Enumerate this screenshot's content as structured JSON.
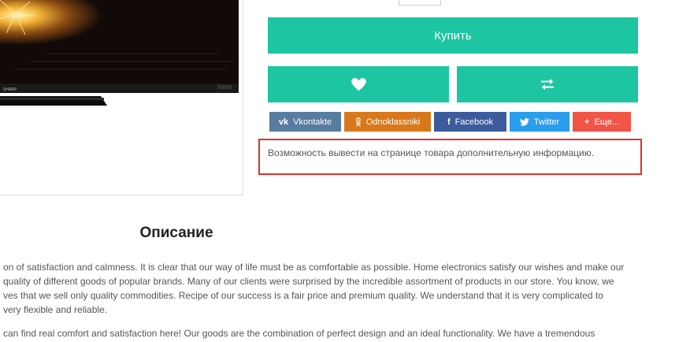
{
  "product": {
    "tv_brand_mark": "SHARP"
  },
  "actions": {
    "buy_label": "Купить",
    "wishlist_icon": "heart-icon",
    "compare_icon": "compare-arrows-icon"
  },
  "share": {
    "vk": {
      "label": "Vkontakte",
      "icon": "vk-icon",
      "color": "#587ba0"
    },
    "ok": {
      "label": "Odnoklassniki",
      "icon": "odnoklassniki-icon",
      "color": "#d9781a"
    },
    "fb": {
      "label": "Facebook",
      "icon": "facebook-icon",
      "color": "#3b5b9c"
    },
    "tw": {
      "label": "Twitter",
      "icon": "twitter-icon",
      "color": "#2b9ded"
    },
    "more": {
      "label": "Еще...",
      "icon": "plus-icon",
      "color": "#f05548"
    }
  },
  "info": {
    "text": "Возможность вывести на странице товара дополнительную информацию."
  },
  "description": {
    "title": "Описание",
    "paragraph1": [
      "on of satisfaction and calmness. It is clear that our way of life must be as comfortable as possible. Home electronics satisfy our wishes and make our",
      "quality of different goods of popular brands. Many of our clients were surprised by the incredible assortment of products in our store. You know, we",
      "ves that we sell only quality commodities. Recipe of our success is a fair price and premium quality. We understand that it is very complicated to",
      "very flexible and reliable."
    ],
    "paragraph2": [
      "can find real comfort and satisfaction here! Our goods are the combination of perfect design and an ideal functionality. We have a tremendous"
    ]
  },
  "colors": {
    "accent": "#1ec5a2",
    "info_border": "#d9342b"
  }
}
